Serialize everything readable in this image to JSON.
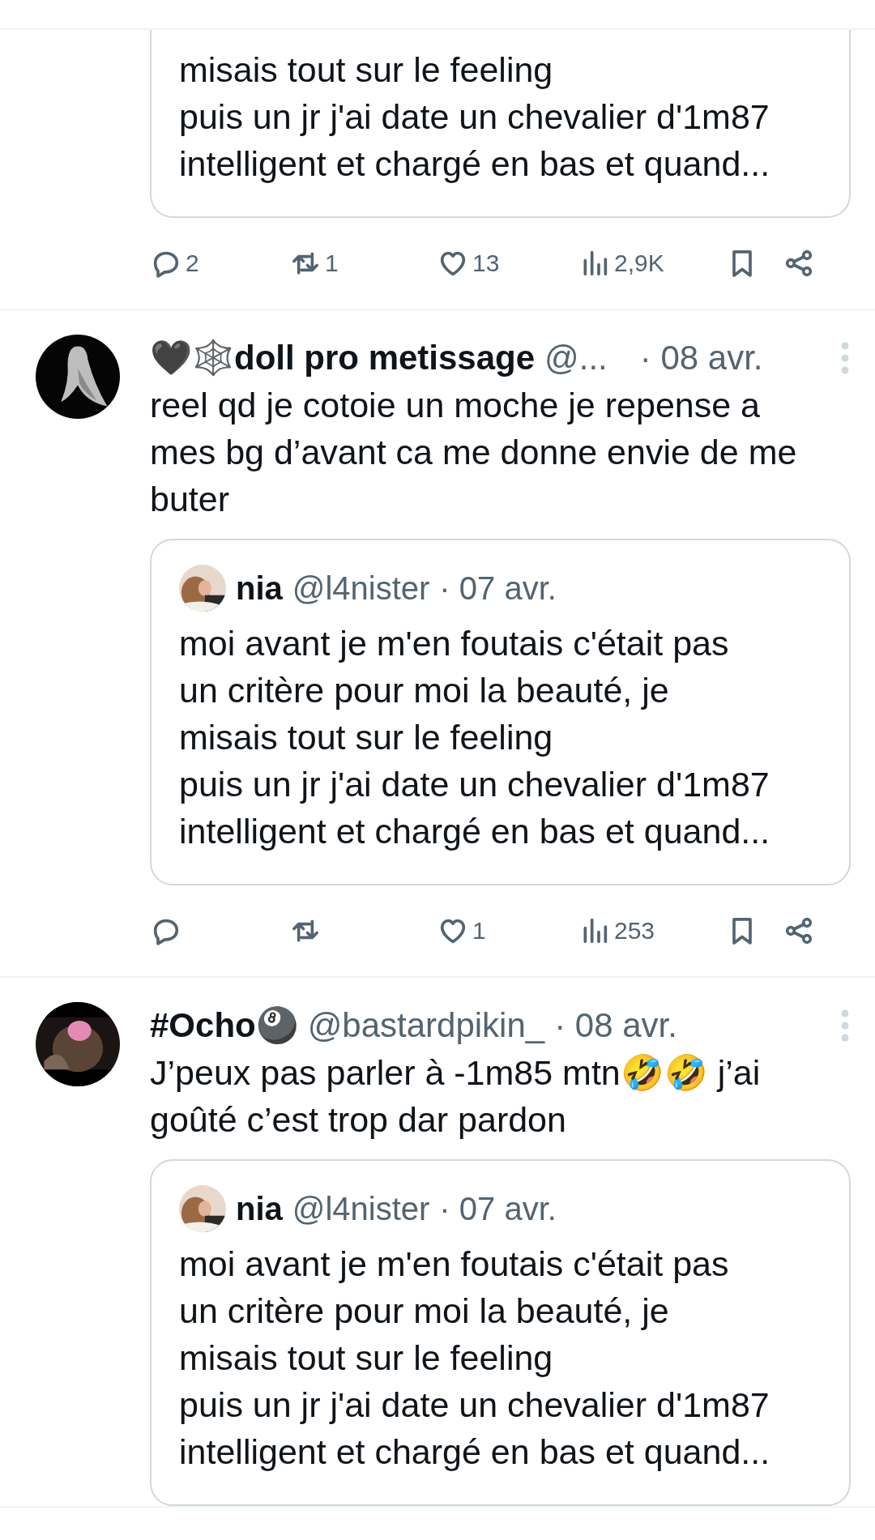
{
  "tweets": [
    {
      "quote": {
        "lines": [
          "misais tout sur le feeling",
          "puis un jr j'ai date un chevalier d'1m87",
          "intelligent et chargé en bas et quand..."
        ]
      },
      "actions": [
        {
          "kind": "reply",
          "count": "2"
        },
        {
          "kind": "retweet",
          "count": "1"
        },
        {
          "kind": "like",
          "count": "13"
        },
        {
          "kind": "views",
          "count": "2,9K"
        },
        {
          "kind": "bookmark"
        },
        {
          "kind": "share"
        }
      ]
    },
    {
      "name": "🖤🕸️doll pro metissage",
      "handle": "@...",
      "date": "· 08 avr.",
      "lines": [
        "reel qd je cotoie un moche je repense a",
        "mes bg d’avant ca me donne envie de me",
        "buter"
      ],
      "quote": {
        "name": "nia",
        "handle": "@l4nister",
        "date": "· 07 avr.",
        "lines": [
          "moi avant je m'en foutais c'était pas",
          "un critère pour moi la beauté, je",
          "misais tout sur le feeling",
          "puis un jr j'ai date un chevalier d'1m87",
          "intelligent et chargé en bas et quand..."
        ]
      },
      "actions": [
        {
          "kind": "reply"
        },
        {
          "kind": "retweet"
        },
        {
          "kind": "like",
          "count": "1"
        },
        {
          "kind": "views",
          "count": "253"
        },
        {
          "kind": "bookmark"
        },
        {
          "kind": "share"
        }
      ]
    },
    {
      "name": "#Ocho🎱",
      "handle": "@bastardpikin_",
      "date": "· 08 avr.",
      "lines": [
        "J’peux pas parler à -1m85 mtn🤣🤣 j’ai",
        "goûté c’est trop dar pardon"
      ],
      "quote": {
        "name": "nia",
        "handle": "@l4nister",
        "date": "· 07 avr.",
        "lines": [
          "moi avant je m'en foutais c'était pas",
          "un critère pour moi la beauté, je",
          "misais tout sur le feeling",
          "puis un jr j'ai date un chevalier d'1m87",
          "intelligent et chargé en bas et quand..."
        ]
      }
    }
  ]
}
